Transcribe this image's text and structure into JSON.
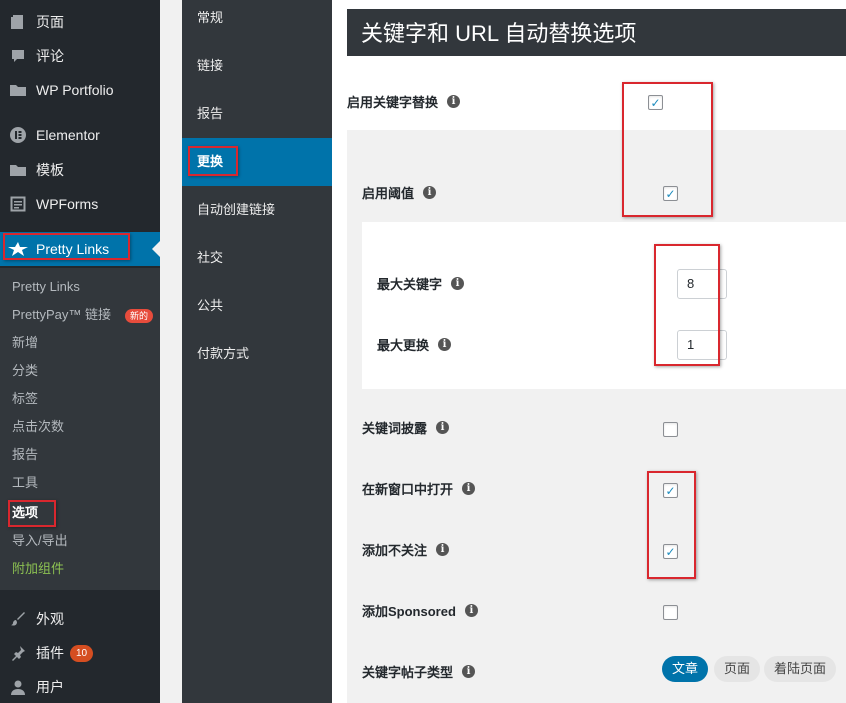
{
  "wp_menu": {
    "top": [
      {
        "icon": "page-icon",
        "label": "页面"
      },
      {
        "icon": "comment-icon",
        "label": "评论"
      },
      {
        "icon": "folder-icon",
        "label": "WP Portfolio"
      },
      {
        "icon": "elementor-icon",
        "label": "Elementor"
      },
      {
        "icon": "folder-icon",
        "label": "模板"
      },
      {
        "icon": "wpforms-icon",
        "label": "WPForms"
      },
      {
        "icon": "pretty-links-star-icon",
        "label": "Pretty Links"
      }
    ],
    "submenu": [
      {
        "label": "Pretty Links"
      },
      {
        "label": "PrettyPay™ 链接",
        "badge": "新的"
      },
      {
        "label": "新增"
      },
      {
        "label": "分类"
      },
      {
        "label": "标签"
      },
      {
        "label": "点击次数"
      },
      {
        "label": "报告"
      },
      {
        "label": "工具"
      },
      {
        "label": "选项"
      },
      {
        "label": "导入/导出"
      },
      {
        "label": "附加组件"
      }
    ],
    "bottom": [
      {
        "icon": "brush-icon",
        "label": "外观"
      },
      {
        "icon": "plugin-icon",
        "label": "插件",
        "count": "10"
      },
      {
        "icon": "user-icon",
        "label": "用户"
      }
    ]
  },
  "options_nav": [
    "常规",
    "链接",
    "报告",
    "更换",
    "自动创建链接",
    "社交",
    "公共",
    "付款方式"
  ],
  "page_title": "关键字和 URL 自动替换选项",
  "options": {
    "enable_keyword_replace": {
      "label": "启用关键字替换",
      "checked": true
    },
    "enable_threshold": {
      "label": "启用阈值",
      "checked": true
    },
    "max_keywords": {
      "label": "最大关键字",
      "value": "8"
    },
    "max_replacements": {
      "label": "最大更换",
      "value": "1"
    },
    "keyword_disclosure": {
      "label": "关键词披露",
      "checked": false
    },
    "open_new_window": {
      "label": "在新窗口中打开",
      "checked": true
    },
    "add_nofollow": {
      "label": "添加不关注",
      "checked": true
    },
    "add_sponsored": {
      "label": "添加Sponsored",
      "checked": false
    },
    "post_types": {
      "label": "关键字帖子类型",
      "pills": [
        "文章",
        "页面",
        "着陆页面"
      ]
    }
  },
  "colors": {
    "accent": "#0073aa",
    "sidebar": "#23282d",
    "highlight_box": "#d9272e"
  }
}
